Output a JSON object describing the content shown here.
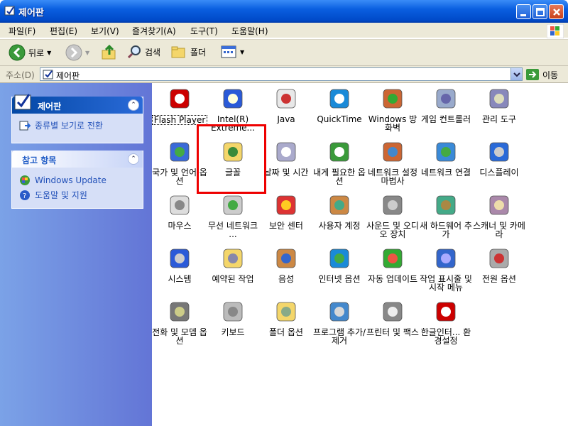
{
  "window": {
    "title": "제어판"
  },
  "menu": [
    "파일(F)",
    "편집(E)",
    "보기(V)",
    "즐겨찾기(A)",
    "도구(T)",
    "도움말(H)"
  ],
  "toolbar": {
    "back": "뒤로",
    "search": "검색",
    "folders": "폴더"
  },
  "address": {
    "label": "주소(D)",
    "value": "제어판",
    "go": "이동"
  },
  "sidebar": {
    "panel1": {
      "title": "제어판",
      "link": "종류별 보기로 전환"
    },
    "panel2": {
      "title": "참고 항목",
      "links": [
        "Windows Update",
        "도움말 및 지원"
      ]
    }
  },
  "items": [
    "Flash Player",
    "Intel(R) Extreme...",
    "Java",
    "QuickTime",
    "Windows 방화벽",
    "게임 컨트롤러",
    "관리 도구",
    "국가 및 언어 옵션",
    "글꼴",
    "날짜 및 시간",
    "내게 필요한 옵션",
    "네트워크 설정 마법사",
    "네트워크 연결",
    "디스플레이",
    "마우스",
    "무선 네트워크 ...",
    "보안 센터",
    "사용자 계정",
    "사운드 및 오디오 장치",
    "새 하드웨어 추가",
    "스캐너 및 카메라",
    "시스템",
    "예약된 작업",
    "음성",
    "인터넷 옵션",
    "자동 업데이트",
    "작업 표시줄 및 시작 메뉴",
    "전원 옵션",
    "전화 및 모뎀 옵션",
    "키보드",
    "폴더 옵션",
    "프로그램 추가/제거",
    "프린터 및 팩스",
    "한글인터... 환경설정"
  ],
  "icons": [
    "flash-player-icon",
    "intel-graphics-icon",
    "java-icon",
    "quicktime-icon",
    "firewall-icon",
    "game-controller-icon",
    "admin-tools-icon",
    "regional-language-icon",
    "fonts-folder-icon",
    "date-time-icon",
    "accessibility-icon",
    "network-wizard-icon",
    "network-connections-icon",
    "display-icon",
    "mouse-icon",
    "wireless-network-icon",
    "security-center-icon",
    "user-accounts-icon",
    "sound-audio-icon",
    "add-hardware-icon",
    "scanner-camera-icon",
    "system-icon",
    "scheduled-tasks-icon",
    "speech-icon",
    "internet-options-icon",
    "automatic-updates-icon",
    "taskbar-start-menu-icon",
    "power-options-icon",
    "phone-modem-icon",
    "keyboard-icon",
    "folder-options-icon",
    "add-remove-programs-icon",
    "printers-fax-icon",
    "hangul-ime-icon"
  ],
  "colors": {
    "titlebar": "#0a5fe0",
    "sidebar": "#6f8fe0",
    "highlight": "#e00000"
  }
}
